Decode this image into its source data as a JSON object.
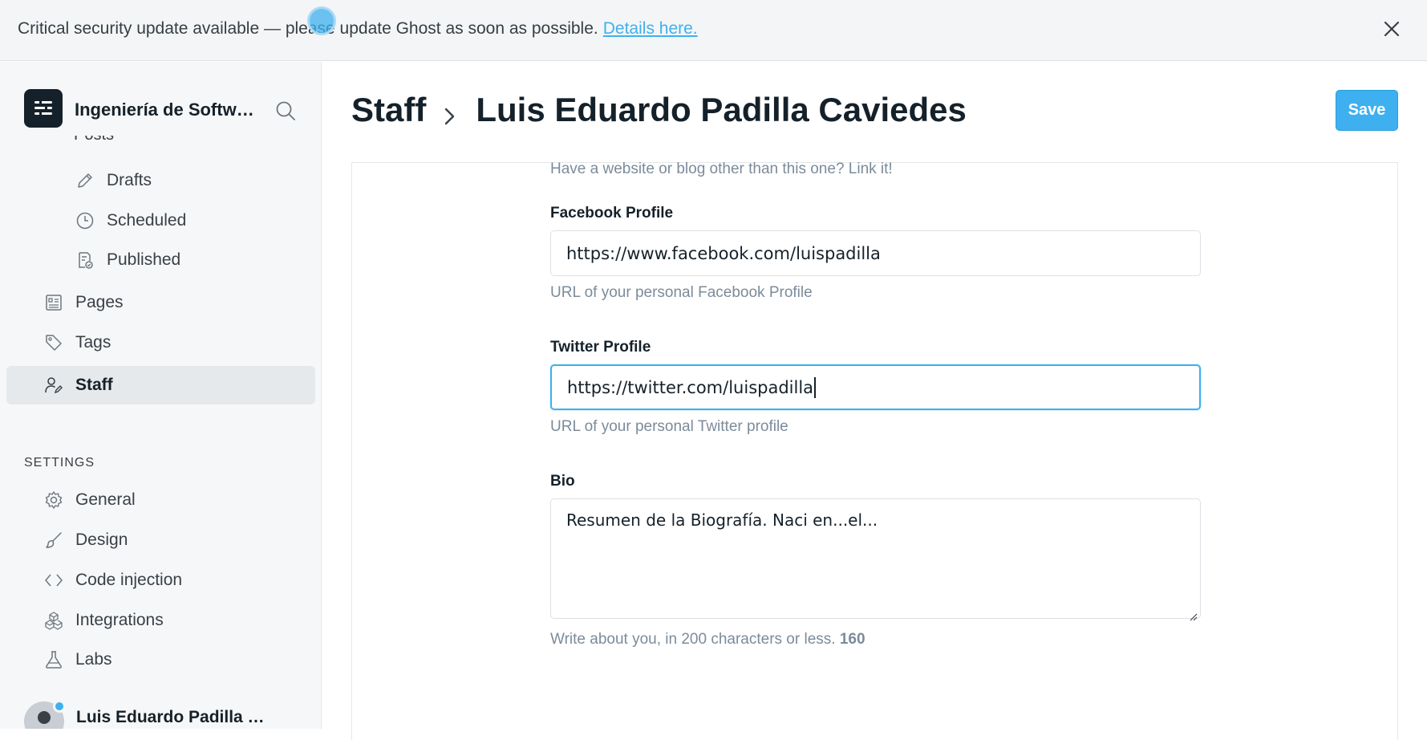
{
  "banner": {
    "message": "Critical security update available — please update Ghost as soon as possible.",
    "link": "Details here."
  },
  "sidebar": {
    "site_name": "Ingeniería de Software",
    "cutoff_item": "Posts",
    "posts_sub": [
      {
        "label": "Drafts",
        "icon": "pencil-icon"
      },
      {
        "label": "Scheduled",
        "icon": "clock-icon"
      },
      {
        "label": "Published",
        "icon": "published-icon"
      }
    ],
    "items": [
      {
        "label": "Pages",
        "icon": "pages-icon"
      },
      {
        "label": "Tags",
        "icon": "tag-icon"
      },
      {
        "label": "Staff",
        "icon": "staff-icon",
        "active": true
      }
    ],
    "settings_heading": "SETTINGS",
    "settings_items": [
      {
        "label": "General",
        "icon": "gear-icon"
      },
      {
        "label": "Design",
        "icon": "brush-icon"
      },
      {
        "label": "Code injection",
        "icon": "code-icon"
      },
      {
        "label": "Integrations",
        "icon": "integrations-icon"
      },
      {
        "label": "Labs",
        "icon": "flask-icon"
      }
    ],
    "user_name": "Luis Eduardo Padilla Caviedes"
  },
  "header": {
    "crumb_parent": "Staff",
    "crumb_current": "Luis Eduardo Padilla Caviedes",
    "save_label": "Save"
  },
  "form": {
    "website_help": "Have a website or blog other than this one? Link it!",
    "facebook": {
      "label": "Facebook Profile",
      "value": "https://www.facebook.com/luispadilla",
      "help": "URL of your personal Facebook Profile"
    },
    "twitter": {
      "label": "Twitter Profile",
      "value": "https://twitter.com/luispadilla",
      "help": "URL of your personal Twitter profile"
    },
    "bio": {
      "label": "Bio",
      "value": "Resumen de la Biografía. Naci en...el...",
      "help": "Write about you, in 200 characters or less.",
      "count": "160"
    }
  },
  "colors": {
    "accent": "#3eb0ef",
    "text": "#15212a",
    "muted": "#7c8b9a"
  }
}
